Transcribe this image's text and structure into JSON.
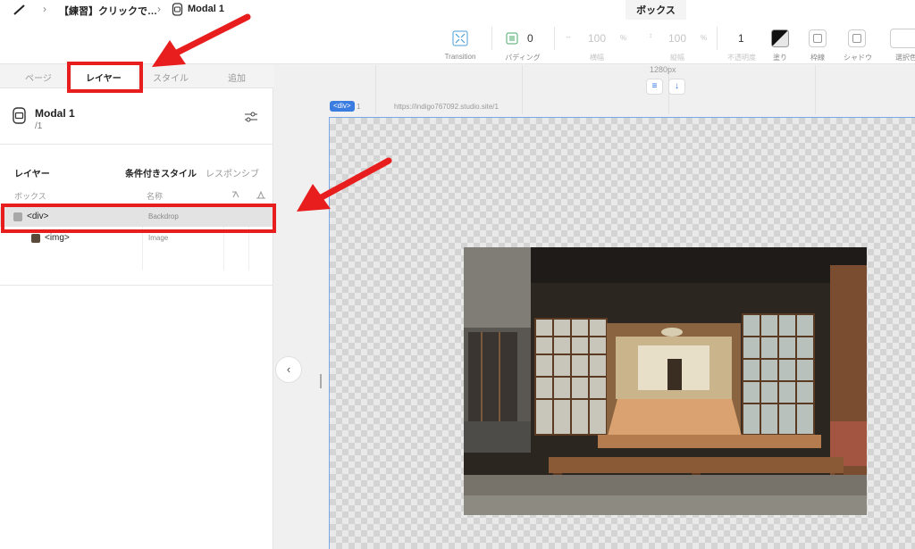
{
  "breadcrumb": {
    "project": "【練習】クリックで…",
    "component": "Modal 1"
  },
  "context_tab": "ボックス",
  "toolbar": {
    "transition_label": "Transition",
    "padding_value": "0",
    "padding_label": "パディング",
    "width_value": "100",
    "width_unit": "%",
    "width_label": "横幅",
    "height_value": "100",
    "height_unit": "%",
    "height_label": "縦幅",
    "opacity_value": "1",
    "opacity_label": "不透明度",
    "fill_label": "塗り",
    "border_label": "枠線",
    "shadow_label": "シャドウ",
    "selected_color_label": "選択色"
  },
  "panel": {
    "tabs": [
      "ページ",
      "レイヤー",
      "スタイル",
      "追加"
    ],
    "active_tab": "レイヤー",
    "component_title": "Modal 1",
    "component_path": "/1",
    "layer_heading": "レイヤー",
    "conditional_style": "条件付きスタイル",
    "responsive": "レスポンシブ",
    "col_box": "ボックス",
    "col_name": "名称",
    "rows": [
      {
        "tag": "<div>",
        "name": "Backdrop",
        "selected": true
      },
      {
        "tag": "<img>",
        "name": "Image",
        "selected": false
      }
    ]
  },
  "canvas": {
    "width_label": "1280px",
    "selected_tag": "<div>",
    "page_num": "1",
    "url": "https://indigo767092.studio.site/1",
    "align_icon": "align-icon",
    "arrow_icon": "arrow-down-icon",
    "collapse_icon": "chevron-left-icon"
  },
  "colors": {
    "annotation_red": "#e81e1e",
    "accent_blue": "#3a7ce0"
  }
}
